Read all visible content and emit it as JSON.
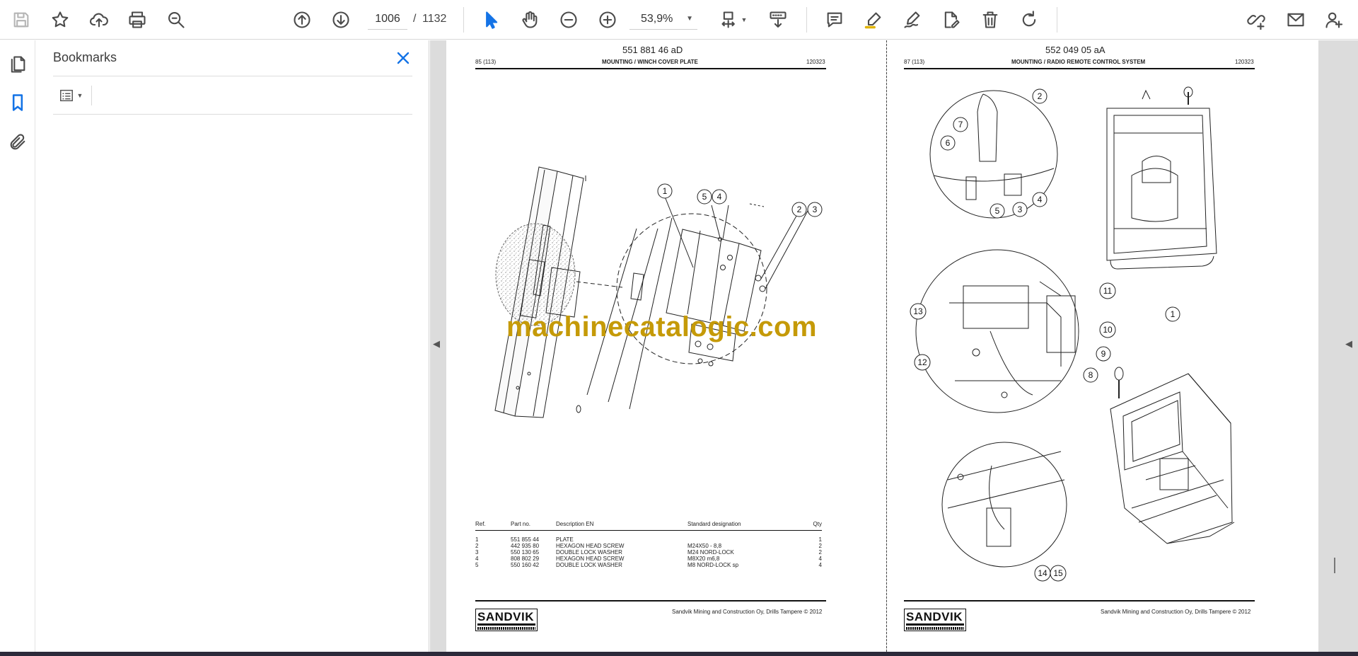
{
  "toolbar": {
    "current_page": "1006",
    "page_sep": "/",
    "total_pages": "1132",
    "zoom_level": "53,9%"
  },
  "bookmarks_panel": {
    "title": "Bookmarks"
  },
  "left_page": {
    "doc_number": "551 881 46 aD",
    "page_ref": "85 (113)",
    "heading": "MOUNTING / WINCH COVER PLATE",
    "date_code": "120323",
    "table_headers": {
      "ref": "Ref.",
      "part": "Part no.",
      "desc": "Description EN",
      "std": "Standard designation",
      "qty": "Qty"
    },
    "parts": [
      {
        "ref": "1",
        "part": "551 855 44",
        "desc": "PLATE",
        "std": "",
        "qty": "1"
      },
      {
        "ref": "2",
        "part": "442 935 80",
        "desc": "HEXAGON HEAD SCREW",
        "std": "M24X50 - 8,8",
        "qty": "2"
      },
      {
        "ref": "3",
        "part": "550 130 65",
        "desc": "DOUBLE LOCK WASHER",
        "std": "M24 NORD-LOCK",
        "qty": "2"
      },
      {
        "ref": "4",
        "part": "808 802 29",
        "desc": "HEXAGON HEAD SCREW",
        "std": "M8X20 m6,8",
        "qty": "4"
      },
      {
        "ref": "5",
        "part": "550 160 42",
        "desc": "DOUBLE LOCK WASHER",
        "std": "M8 NORD-LOCK sp",
        "qty": "4"
      }
    ],
    "brand": "SANDVIK",
    "footer": "Sandvik Mining and Construction Oy, Drills Tampere © 2012",
    "callouts": [
      "1",
      "5",
      "4",
      "2",
      "3"
    ]
  },
  "right_page": {
    "doc_number": "552 049 05 aA",
    "page_ref": "87 (113)",
    "heading": "MOUNTING / RADIO REMOTE CONTROL SYSTEM",
    "date_code": "120323",
    "brand": "SANDVIK",
    "footer": "Sandvik Mining and Construction Oy, Drills Tampere © 2012",
    "callouts": [
      "2",
      "7",
      "6",
      "5",
      "3",
      "4",
      "11",
      "1",
      "13",
      "10",
      "9",
      "12",
      "8",
      "14",
      "15"
    ]
  },
  "watermark": "machinecatalogic.com",
  "icons": {
    "save": "save-icon",
    "bookmark": "star-icon",
    "upload": "cloud-upload-icon",
    "print": "printer-icon",
    "find": "search-icon",
    "prev": "arrow-up-circle-icon",
    "next": "arrow-down-circle-icon",
    "select": "pointer-icon",
    "hand": "hand-icon",
    "zoom_out": "zoom-out-icon",
    "zoom_in": "zoom-in-icon",
    "fit": "page-fit-icon",
    "scroll_mode": "scroll-mode-icon",
    "comment": "comment-icon",
    "highlight": "highlighter-icon",
    "sign": "sign-icon",
    "edit": "edit-document-icon",
    "delete": "trash-icon",
    "rotate": "rotate-icon",
    "share_link": "share-link-icon",
    "email": "email-icon",
    "add_user": "add-user-icon",
    "pages": "page-thumbnails-icon",
    "bookmarks": "bookmark-icon",
    "attachments": "paperclip-icon",
    "options": "bookmark-options-icon",
    "close": "close-icon"
  }
}
